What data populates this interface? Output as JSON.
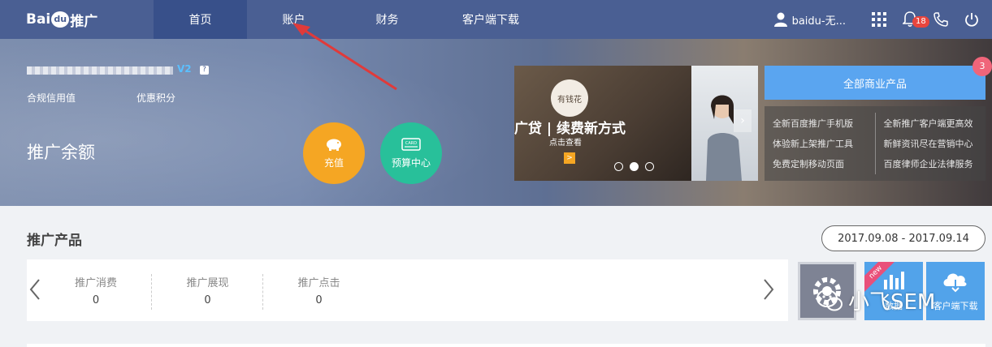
{
  "brand": {
    "logo_text_left": "Bai",
    "logo_text_paw": "du",
    "logo_text_right": "推广"
  },
  "nav": {
    "items": [
      {
        "label": "首页",
        "active": true
      },
      {
        "label": "账户",
        "active": false
      },
      {
        "label": "财务",
        "active": false
      },
      {
        "label": "客户端下载",
        "active": false
      }
    ],
    "user_name": "baidu-无...",
    "notification_count": "18"
  },
  "account": {
    "level_badge": "V2",
    "help_mark": "?",
    "credit_label": "合规信用值",
    "points_label": "优惠积分",
    "balance_label": "推广余额"
  },
  "actions": {
    "recharge_label": "充值",
    "budget_label": "预算中心",
    "budget_card_text": "CARD"
  },
  "banner": {
    "tag": "有钱花",
    "slogan": "广贷 | 续费新方式",
    "sub": "点击查看",
    "go": ">",
    "side_arrow": "›",
    "dots_active_index": 1
  },
  "products": {
    "all_label": "全部商业产品",
    "count": "3",
    "links_left": [
      "全新百度推广手机版",
      "体验新上架推广工具",
      "免费定制移动页面"
    ],
    "links_right": [
      "全新推广客户端更高效",
      "新鲜资讯尽在营销中心",
      "百度律师企业法律服务"
    ]
  },
  "section": {
    "title": "推广产品",
    "date_range": "2017.09.08 - 2017.09.14"
  },
  "stats": [
    {
      "label": "推广消费",
      "value": "0"
    },
    {
      "label": "推广展现",
      "value": "0"
    },
    {
      "label": "推广点击",
      "value": "0"
    }
  ],
  "tiles": {
    "new_ribbon": "new",
    "report_label": "数据",
    "download_label": "客户端下载"
  },
  "watermark": "小飞SEM",
  "colors": {
    "nav_bg": "#4a5f93",
    "accent_blue": "#5aa5f0",
    "recharge": "#f5a623",
    "budget": "#28c09a",
    "badge_red": "#e9453d"
  }
}
